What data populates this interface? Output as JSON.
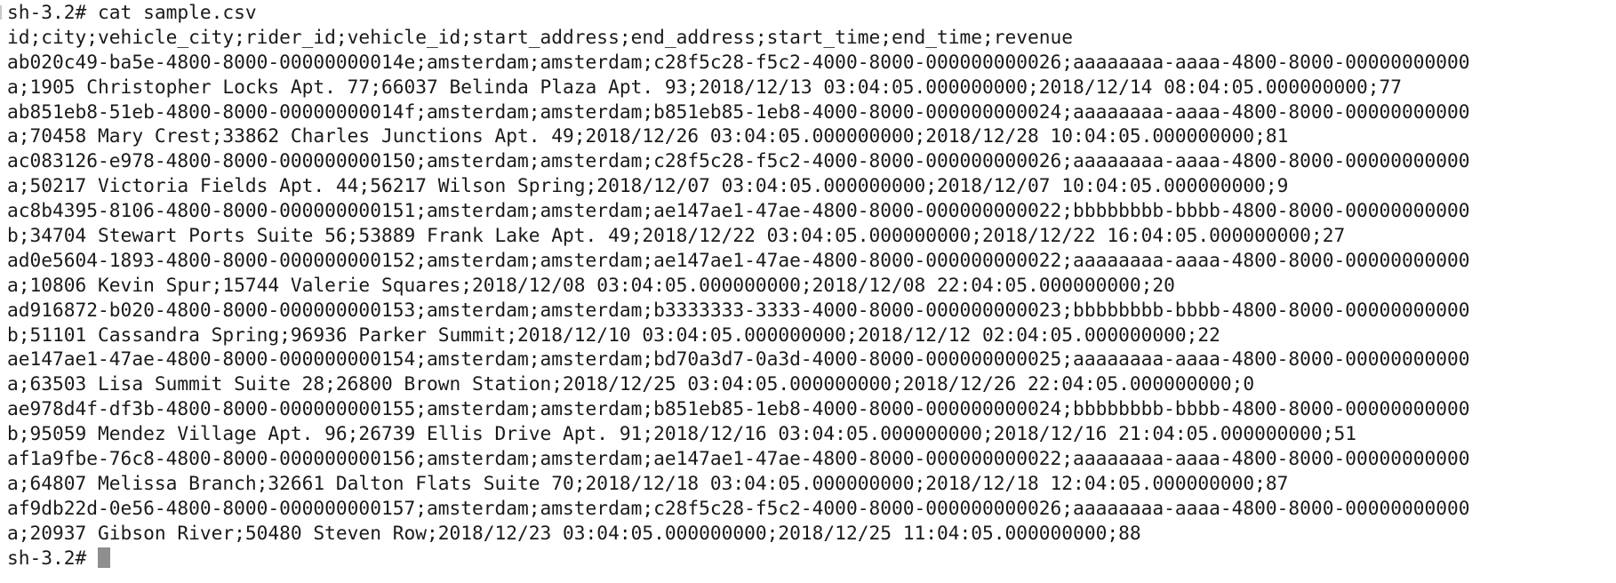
{
  "terminal": {
    "lines": [
      "sh-3.2# cat sample.csv",
      "id;city;vehicle_city;rider_id;vehicle_id;start_address;end_address;start_time;end_time;revenue",
      "ab020c49-ba5e-4800-8000-00000000014e;amsterdam;amsterdam;c28f5c28-f5c2-4000-8000-000000000026;aaaaaaaa-aaaa-4800-8000-00000000000",
      "a;1905 Christopher Locks Apt. 77;66037 Belinda Plaza Apt. 93;2018/12/13 03:04:05.000000000;2018/12/14 08:04:05.000000000;77",
      "ab851eb8-51eb-4800-8000-00000000014f;amsterdam;amsterdam;b851eb85-1eb8-4000-8000-000000000024;aaaaaaaa-aaaa-4800-8000-00000000000",
      "a;70458 Mary Crest;33862 Charles Junctions Apt. 49;2018/12/26 03:04:05.000000000;2018/12/28 10:04:05.000000000;81",
      "ac083126-e978-4800-8000-000000000150;amsterdam;amsterdam;c28f5c28-f5c2-4000-8000-000000000026;aaaaaaaa-aaaa-4800-8000-00000000000",
      "a;50217 Victoria Fields Apt. 44;56217 Wilson Spring;2018/12/07 03:04:05.000000000;2018/12/07 10:04:05.000000000;9",
      "ac8b4395-8106-4800-8000-000000000151;amsterdam;amsterdam;ae147ae1-47ae-4800-8000-000000000022;bbbbbbbb-bbbb-4800-8000-00000000000",
      "b;34704 Stewart Ports Suite 56;53889 Frank Lake Apt. 49;2018/12/22 03:04:05.000000000;2018/12/22 16:04:05.000000000;27",
      "ad0e5604-1893-4800-8000-000000000152;amsterdam;amsterdam;ae147ae1-47ae-4800-8000-000000000022;aaaaaaaa-aaaa-4800-8000-00000000000",
      "a;10806 Kevin Spur;15744 Valerie Squares;2018/12/08 03:04:05.000000000;2018/12/08 22:04:05.000000000;20",
      "ad916872-b020-4800-8000-000000000153;amsterdam;amsterdam;b3333333-3333-4000-8000-000000000023;bbbbbbbb-bbbb-4800-8000-00000000000",
      "b;51101 Cassandra Spring;96936 Parker Summit;2018/12/10 03:04:05.000000000;2018/12/12 02:04:05.000000000;22",
      "ae147ae1-47ae-4800-8000-000000000154;amsterdam;amsterdam;bd70a3d7-0a3d-4000-8000-000000000025;aaaaaaaa-aaaa-4800-8000-00000000000",
      "a;63503 Lisa Summit Suite 28;26800 Brown Station;2018/12/25 03:04:05.000000000;2018/12/26 22:04:05.000000000;0",
      "ae978d4f-df3b-4800-8000-000000000155;amsterdam;amsterdam;b851eb85-1eb8-4000-8000-000000000024;bbbbbbbb-bbbb-4800-8000-00000000000",
      "b;95059 Mendez Village Apt. 96;26739 Ellis Drive Apt. 91;2018/12/16 03:04:05.000000000;2018/12/16 21:04:05.000000000;51",
      "af1a9fbe-76c8-4800-8000-000000000156;amsterdam;amsterdam;ae147ae1-47ae-4800-8000-000000000022;aaaaaaaa-aaaa-4800-8000-00000000000",
      "a;64807 Melissa Branch;32661 Dalton Flats Suite 70;2018/12/18 03:04:05.000000000;2018/12/18 12:04:05.000000000;87",
      "af9db22d-0e56-4800-8000-000000000157;amsterdam;amsterdam;c28f5c28-f5c2-4000-8000-000000000026;aaaaaaaa-aaaa-4800-8000-00000000000",
      "a;20937 Gibson River;50480 Steven Row;2018/12/23 03:04:05.000000000;2018/12/25 11:04:05.000000000;88"
    ],
    "prompt": "sh-3.2# "
  }
}
